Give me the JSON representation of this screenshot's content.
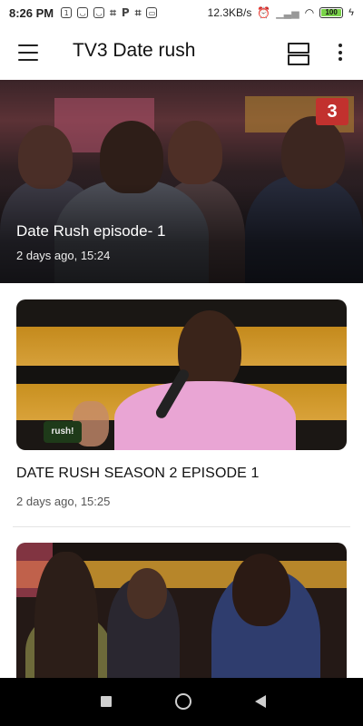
{
  "status_bar": {
    "time": "8:26 PM",
    "net_speed": "12.3KB/s",
    "battery": "100",
    "notification_icons": [
      "calendar-icon",
      "app-icon",
      "app-icon",
      "slack-icon",
      "p-icon",
      "slack-icon",
      "app-icon"
    ],
    "battery_color": "#7ad34a"
  },
  "app_bar": {
    "title": "TV3 Date rush",
    "menu_icon": "menu-icon",
    "view_toggle_icon": "view-toggle-icon",
    "more_icon": "more-vert-icon"
  },
  "featured": {
    "title": "Date Rush episode- 1",
    "meta": "2 days ago, 15:24",
    "logo": "3"
  },
  "videos": [
    {
      "title": "DATE RUSH SEASON 2 EPISODE 1",
      "meta": "2 days ago, 15:25",
      "badge": "rush!"
    },
    {
      "title": "",
      "meta": ""
    }
  ],
  "nav_bar": {
    "recents_icon": "square-icon",
    "home_icon": "circle-icon",
    "back_icon": "back-triangle-icon"
  }
}
